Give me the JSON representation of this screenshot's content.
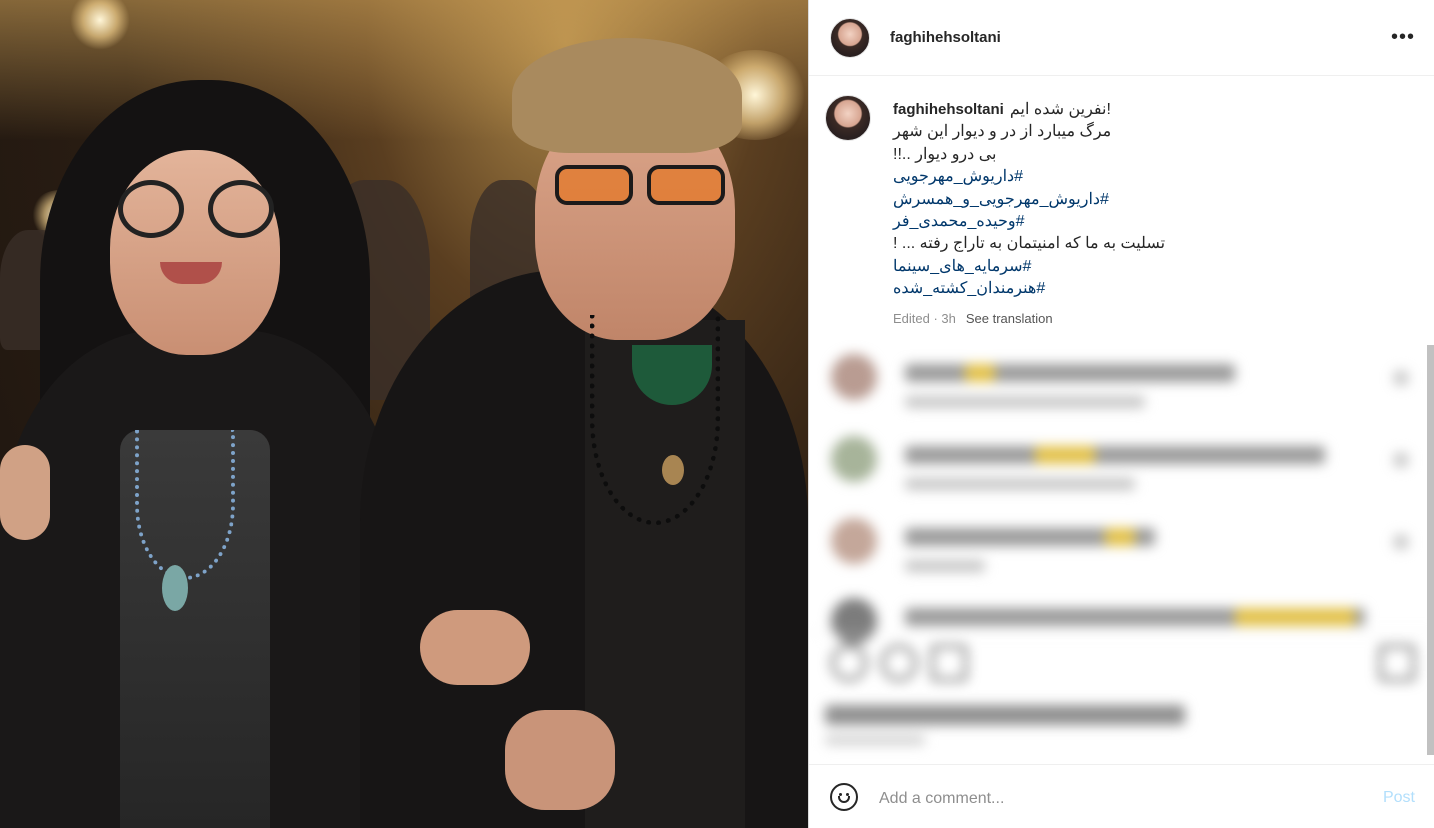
{
  "post": {
    "username": "faghihehsoltani",
    "more_icon": "more-horizontal-icon",
    "caption_lines": [
      "نفرین شده ایم!",
      "مرگ میبارد از در و دیوار این شهر",
      "بی درو دیوار ..!!"
    ],
    "hashtags_a": [
      "#داریوش_مهرجویی",
      "#داریوش_مهرجویی_و_همسرش",
      "#وحیده_محمدی_فر"
    ],
    "condolence": "تسلیت به ما که امنیتمان به تاراج رفته ... !",
    "hashtags_b": [
      "#سرمایه_های_سینما",
      "#هنرمندان_کشته_شده"
    ],
    "meta": {
      "edited": "Edited · 3h",
      "see_translation": "See translation"
    }
  },
  "comment_box": {
    "placeholder": "Add a comment...",
    "post_label": "Post",
    "emoji_icon": "smiley-icon"
  },
  "colors": {
    "hashtag": "#00376b",
    "post_button": "#b2dffc",
    "muted": "#8e8e8e"
  }
}
